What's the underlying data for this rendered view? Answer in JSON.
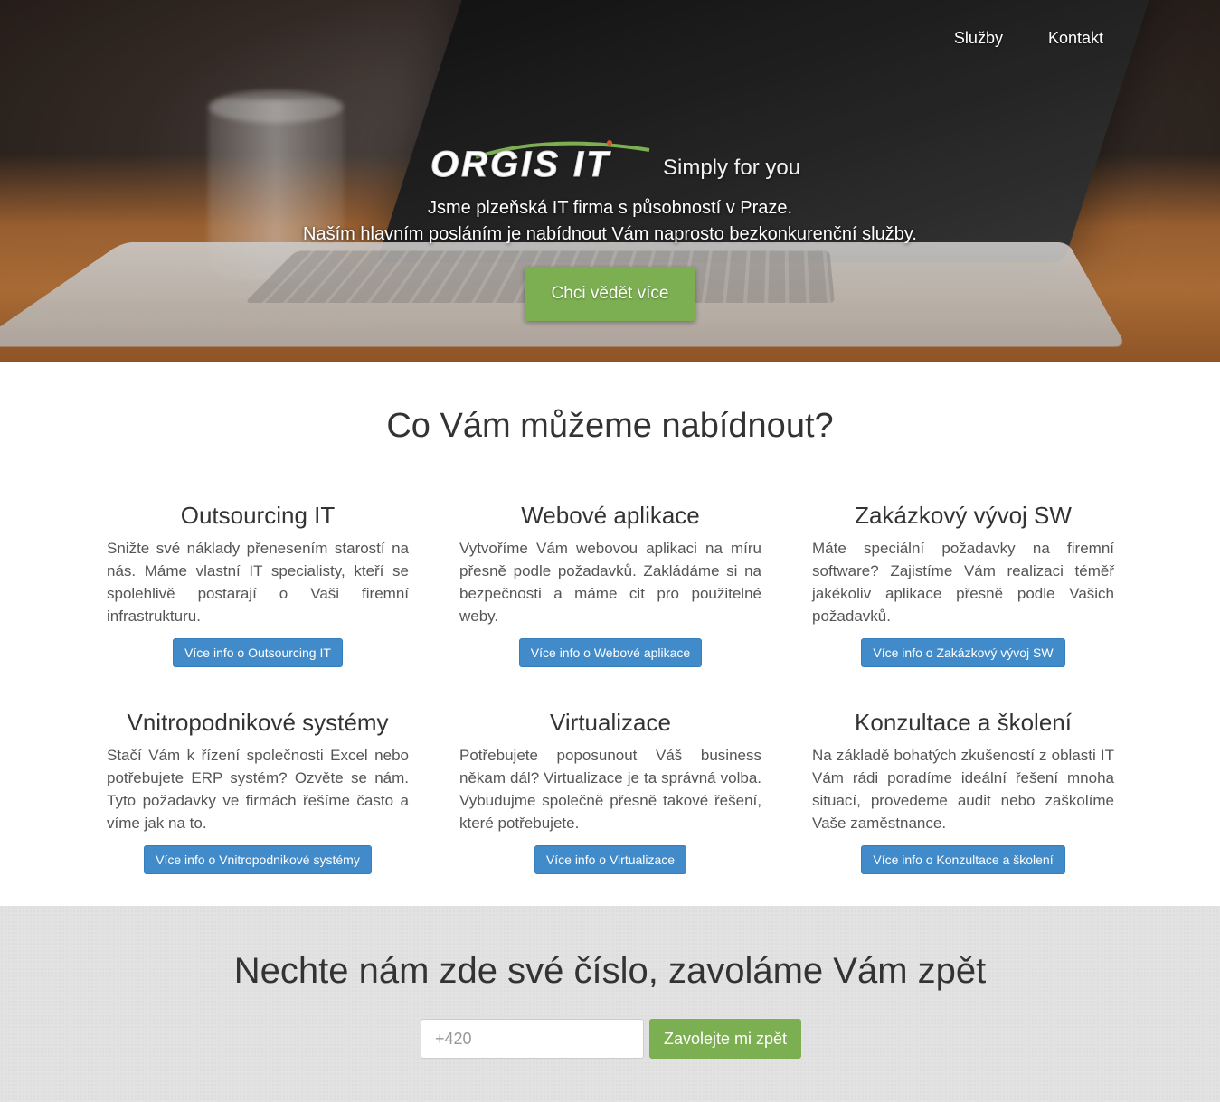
{
  "nav": {
    "items": [
      "Služby",
      "Kontakt"
    ]
  },
  "hero": {
    "logo": "ORGIS IT",
    "slogan": "Simply for you",
    "line1": "Jsme plzeňská IT firma s působností v Praze.",
    "line2": "Naším hlavním posláním je nabídnout Vám naprosto bezkonkurenční služby.",
    "cta": "Chci vědět více"
  },
  "services": {
    "title": "Co Vám můžeme nabídnout?",
    "items": [
      {
        "title": "Outsourcing IT",
        "text": "Snižte své náklady přenesením starostí na nás. Máme vlastní IT specialisty, kteří se spolehlivě postarají o Vaši firemní infrastrukturu.",
        "button": "Více info o Outsourcing IT"
      },
      {
        "title": "Webové aplikace",
        "text": "Vytvoříme Vám webovou aplikaci na míru přesně podle požadavků. Zakládáme si na bezpečnosti a máme cit pro použitelné weby.",
        "button": "Více info o Webové aplikace"
      },
      {
        "title": "Zakázkový vývoj SW",
        "text": "Máte speciální požadavky na firemní software? Zajistíme Vám realizaci téměř jakékoliv aplikace přesně podle Vašich požadavků.",
        "button": "Více info o Zakázkový vývoj SW"
      },
      {
        "title": "Vnitropodnikové systémy",
        "text": "Stačí Vám k řízení společnosti Excel nebo potřebujete ERP systém? Ozvěte se nám. Tyto požadavky ve firmách řešíme často a víme jak na to.",
        "button": "Více info o Vnitropodnikové systémy"
      },
      {
        "title": "Virtualizace",
        "text": "Potřebujete poposunout Váš business někam dál? Virtualizace je ta správná volba. Vybudujme společně přesně takové řešení, které potřebujete.",
        "button": "Více info o Virtualizace"
      },
      {
        "title": "Konzultace a školení",
        "text": "Na základě bohatých zkušeností z oblasti IT Vám rádi poradíme ideální řešení mnoha situací, provedeme audit nebo zaškolíme Vaše zaměstnance.",
        "button": "Více info o Konzultace a školení"
      }
    ]
  },
  "callback": {
    "title": "Nechte nám zde své číslo, zavoláme Vám zpět",
    "placeholder": "+420",
    "button": "Zavolejte mi zpět"
  },
  "colors": {
    "green": "#7cae52",
    "blue": "#428bca",
    "gray_bg": "#e2e2e2"
  }
}
